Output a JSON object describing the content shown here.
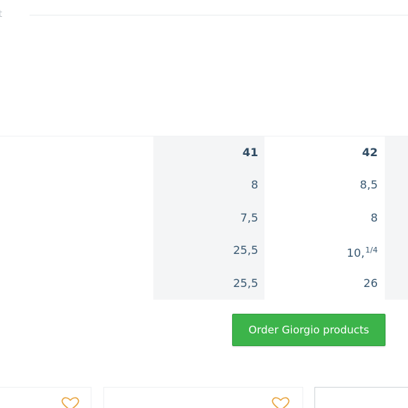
{
  "top_tab": {
    "label": "t"
  },
  "size_table": {
    "columns": [
      "41",
      "42"
    ],
    "rows": [
      {
        "col_41": "8",
        "col_42": "8,5"
      },
      {
        "col_41": "7,5",
        "col_42": "8"
      },
      {
        "col_41": "25,5",
        "col_42": "10,",
        "col_42_fraction": "1/4"
      },
      {
        "col_41": "25,5",
        "col_42": "26"
      }
    ]
  },
  "order_button": {
    "label": "Order Giorgio products"
  },
  "colors": {
    "accent_green": "#3cb44a",
    "heart_orange": "#e8a33d",
    "table_text": "#3b5a73",
    "column_highlight": "#f4f5f6"
  },
  "product_cards": [
    {
      "icon": "heart-icon"
    },
    {
      "icon": "heart-icon"
    },
    {
      "icon": ""
    }
  ]
}
